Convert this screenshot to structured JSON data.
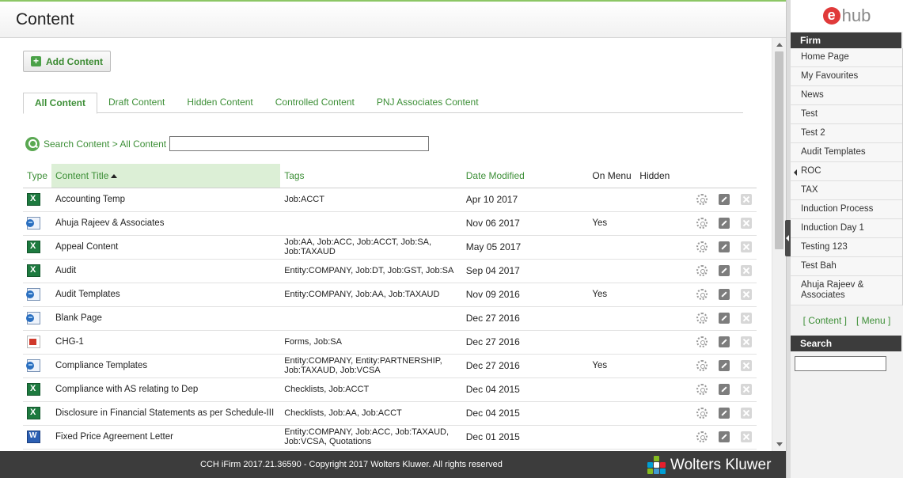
{
  "header": {
    "title": "Content"
  },
  "toolbar": {
    "add_label": "Add Content"
  },
  "tabs": [
    {
      "label": "All Content",
      "active": true
    },
    {
      "label": "Draft Content"
    },
    {
      "label": "Hidden Content"
    },
    {
      "label": "Controlled Content"
    },
    {
      "label": "PNJ Associates Content"
    }
  ],
  "search": {
    "crumb": "Search Content > All Content",
    "value": ""
  },
  "table": {
    "columns": {
      "type": "Type",
      "title": "Content Title",
      "tags": "Tags",
      "date": "Date Modified",
      "menu": "On Menu",
      "hidden": "Hidden"
    },
    "rows": [
      {
        "icon": "xls",
        "title": "Accounting Temp",
        "tags": "Job:ACCT",
        "date": "Apr 10 2017",
        "menu": ""
      },
      {
        "icon": "web",
        "title": "Ahuja Rajeev & Associates",
        "tags": "",
        "date": "Nov 06 2017",
        "menu": "Yes"
      },
      {
        "icon": "xls",
        "title": "Appeal Content",
        "tags": "Job:AA, Job:ACC, Job:ACCT, Job:SA, Job:TAXAUD",
        "date": "May 05 2017",
        "menu": ""
      },
      {
        "icon": "xls",
        "title": "Audit",
        "tags": "Entity:COMPANY, Job:DT, Job:GST, Job:SA",
        "date": "Sep 04 2017",
        "menu": ""
      },
      {
        "icon": "web",
        "title": "Audit Templates",
        "tags": "Entity:COMPANY, Job:AA, Job:TAXAUD",
        "date": "Nov 09 2016",
        "menu": "Yes"
      },
      {
        "icon": "web",
        "title": "Blank Page",
        "tags": "",
        "date": "Dec 27 2016",
        "menu": ""
      },
      {
        "icon": "pdf",
        "title": "CHG-1",
        "tags": "Forms, Job:SA",
        "date": "Dec 27 2016",
        "menu": ""
      },
      {
        "icon": "web",
        "title": "Compliance Templates",
        "tags": "Entity:COMPANY, Entity:PARTNERSHIP, Job:TAXAUD, Job:VCSA",
        "date": "Dec 27 2016",
        "menu": "Yes"
      },
      {
        "icon": "xls",
        "title": "Compliance with AS relating to Dep",
        "tags": "Checklists, Job:ACCT",
        "date": "Dec 04 2015",
        "menu": ""
      },
      {
        "icon": "xls",
        "title": "Disclosure in Financial Statements as per Schedule-III",
        "tags": "Checklists, Job:AA, Job:ACCT",
        "date": "Dec 04 2015",
        "menu": ""
      },
      {
        "icon": "doc",
        "title": "Fixed Price Agreement Letter",
        "tags": "Entity:COMPANY, Job:ACC, Job:TAXAUD, Job:VCSA, Quotations",
        "date": "Dec 01 2015",
        "menu": ""
      }
    ]
  },
  "footer": {
    "copyright": "CCH iFirm 2017.21.36590 - Copyright 2017 Wolters Kluwer. All rights reserved",
    "brand": "Wolters Kluwer"
  },
  "sidebar": {
    "logo_e": "e",
    "logo_hub": "hub",
    "firm_heading": "Firm",
    "items": [
      {
        "label": "Home Page"
      },
      {
        "label": "My Favourites"
      },
      {
        "label": "News"
      },
      {
        "label": "Test"
      },
      {
        "label": "Test 2"
      },
      {
        "label": "Audit Templates"
      },
      {
        "label": "ROC",
        "arrow": true
      },
      {
        "label": "TAX"
      },
      {
        "label": "Induction Process"
      },
      {
        "label": "Induction Day 1"
      },
      {
        "label": "Testing 123"
      },
      {
        "label": "Test Bah"
      },
      {
        "label": "Ahuja Rajeev & Associates"
      }
    ],
    "content_link": "[ Content ]",
    "menu_link": "[ Menu ]",
    "search_heading": "Search",
    "search_value": ""
  },
  "colors": {
    "accent_green": "#3d8f37",
    "dark_bar": "#3c3c3c",
    "brand_red": "#e03a3a"
  }
}
